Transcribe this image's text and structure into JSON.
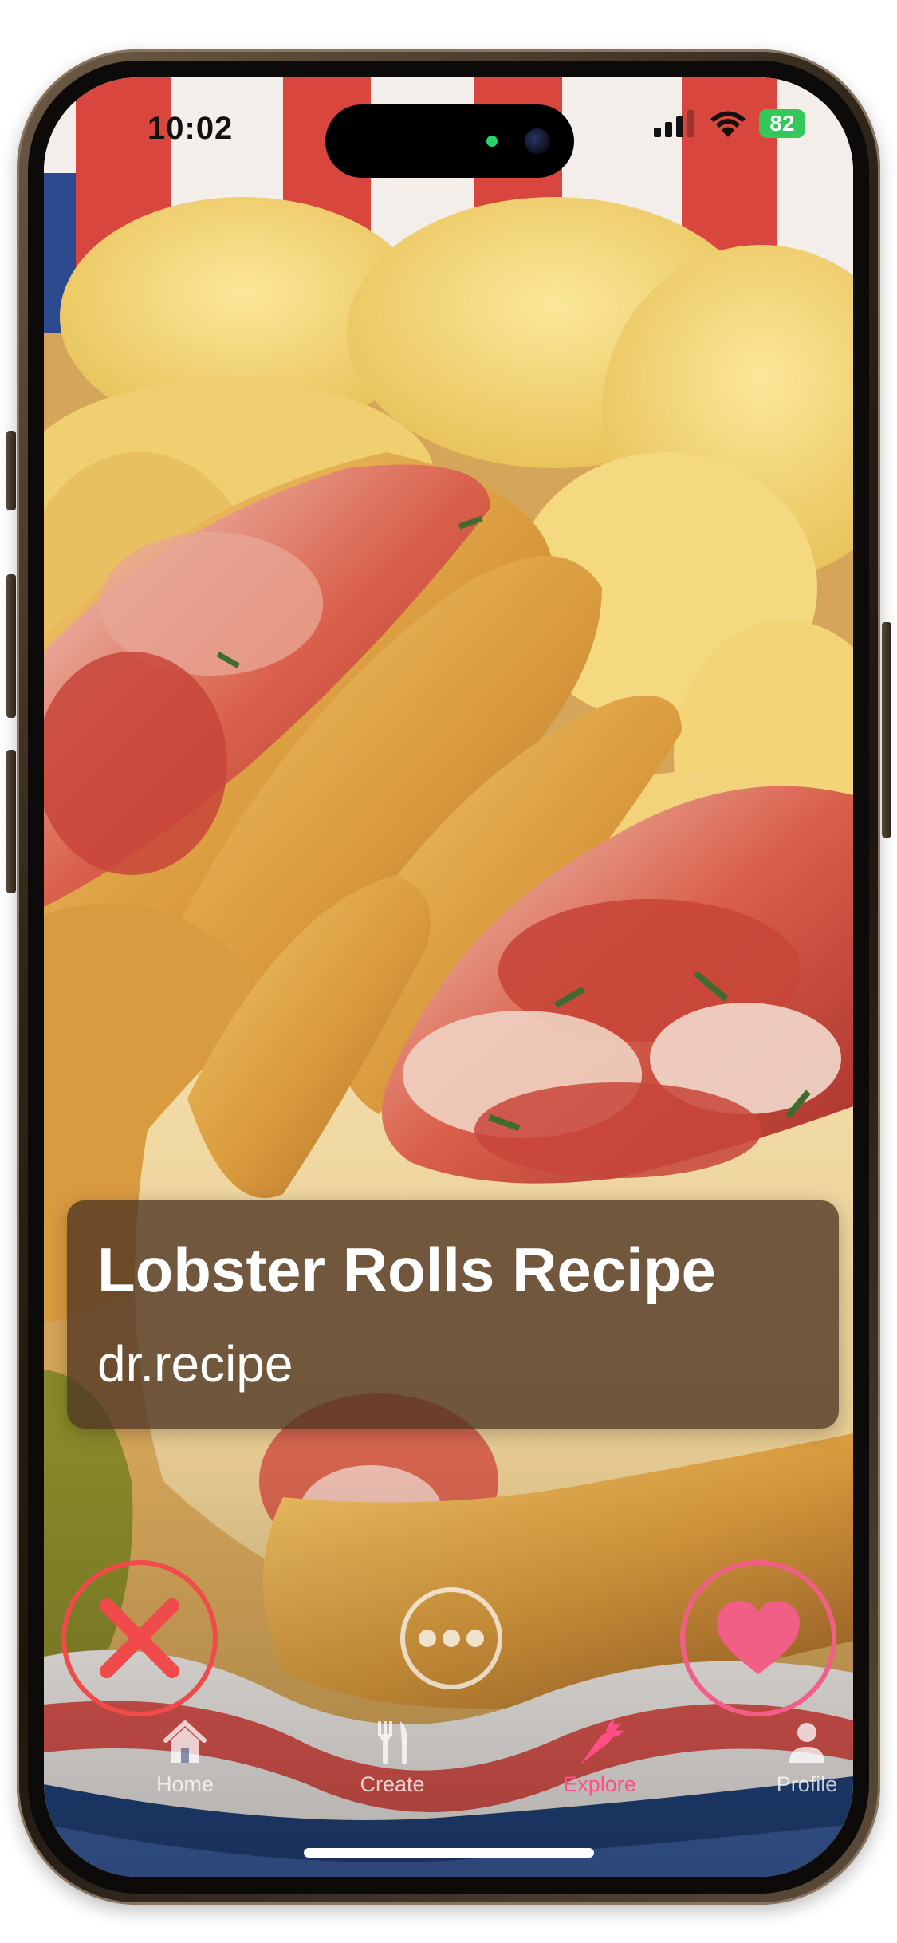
{
  "status_bar": {
    "time": "10:02",
    "battery": "82"
  },
  "recipe": {
    "title": "Lobster Rolls Recipe",
    "author": "dr.recipe"
  },
  "actions": {
    "dislike_icon": "close-icon",
    "more_icon": "ellipsis-icon",
    "like_icon": "heart-icon"
  },
  "tabs": [
    {
      "label": "Home",
      "icon": "house-icon"
    },
    {
      "label": "Create",
      "icon": "fork-knife-icon"
    },
    {
      "label": "Explore",
      "icon": "carrot-icon",
      "active": true
    },
    {
      "label": "Profile",
      "icon": "person-icon"
    }
  ],
  "colors": {
    "accent_pink": "#ff4f86",
    "dislike_red": "#f04a4a",
    "battery_green": "#34c759"
  }
}
